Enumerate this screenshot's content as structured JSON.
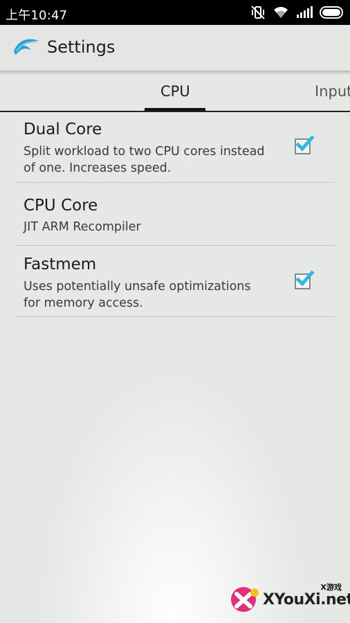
{
  "statusbar": {
    "time": "上午10:47"
  },
  "header": {
    "title": "Settings"
  },
  "tabs": [
    {
      "label": "CPU",
      "selected": true
    },
    {
      "label": "Input",
      "selected": false
    }
  ],
  "settings": [
    {
      "title": "Dual Core",
      "summary_line1": "Split workload to two CPU cores instead",
      "summary_line2": "of one. Increases speed.",
      "checked": true
    },
    {
      "title": "CPU Core",
      "summary": "JIT ARM Recompiler"
    },
    {
      "title": "Fastmem",
      "summary_line1": "Uses potentially unsafe optimizations",
      "summary_line2": "for memory access.",
      "checked": true
    }
  ],
  "watermark": {
    "small": "X游戏",
    "main": "XYouXi.net"
  },
  "colors": {
    "accent": "#33b5e5",
    "actionbar": "#e4e6e3"
  }
}
